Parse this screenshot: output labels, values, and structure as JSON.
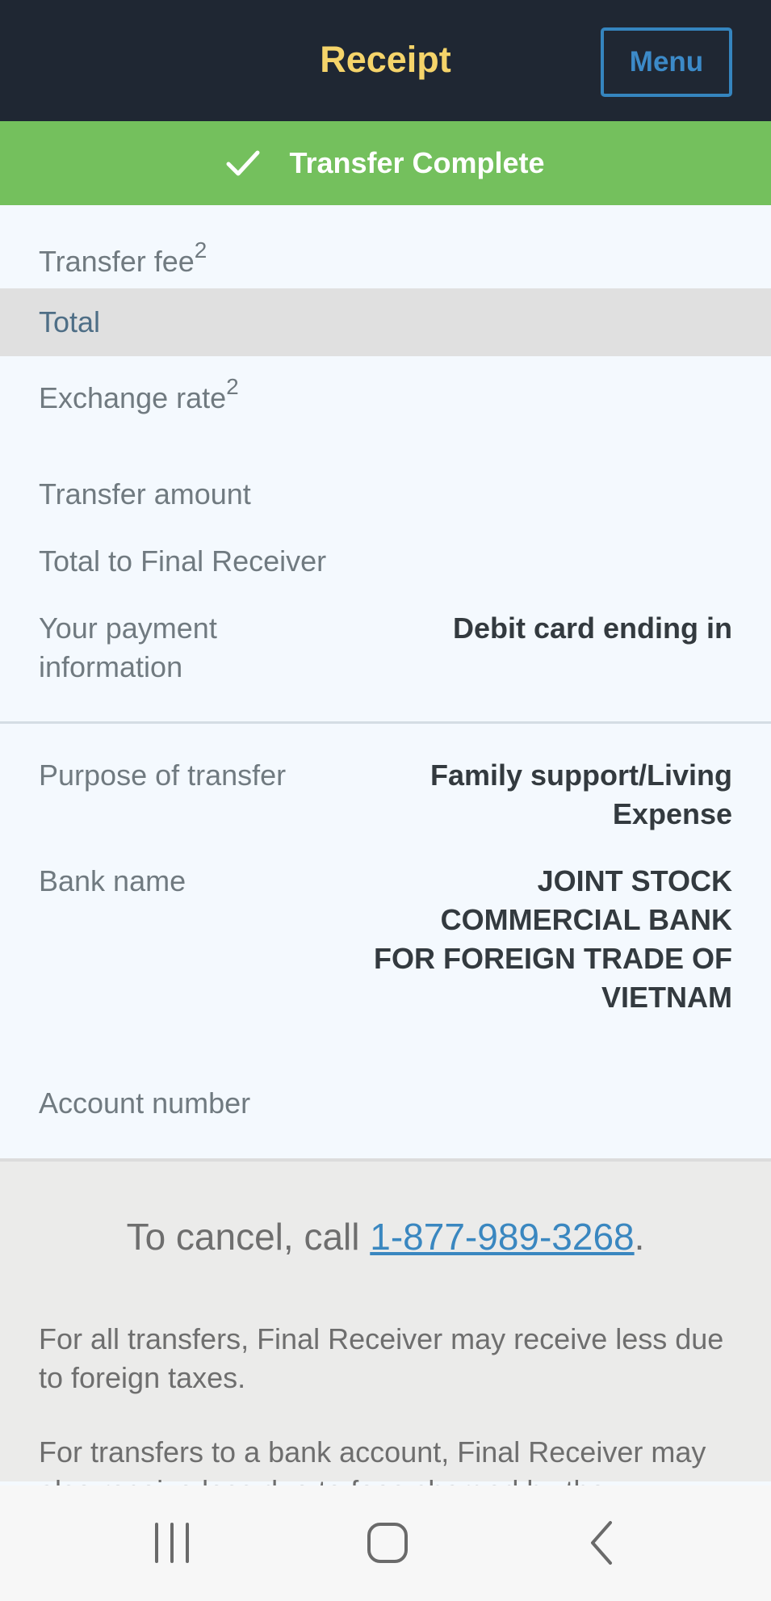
{
  "header": {
    "title": "Receipt",
    "menu_label": "Menu"
  },
  "banner": {
    "icon": "check-icon",
    "text": "Transfer Complete"
  },
  "receipt": {
    "transfer_fee_label": "Transfer fee",
    "transfer_fee_sup": "2",
    "total_label": "Total",
    "exchange_rate_label": "Exchange rate",
    "exchange_rate_sup": "2",
    "transfer_amount_label": "Transfer amount",
    "total_final_label": "Total to Final Receiver",
    "payment_label_line1": "Your payment",
    "payment_label_line2": "information",
    "payment_value": "Debit card ending in",
    "purpose_label": "Purpose of transfer",
    "purpose_value_line1": "Family support/Living",
    "purpose_value_line2": "Expense",
    "bank_label": "Bank name",
    "bank_value_line1": "JOINT STOCK",
    "bank_value_line2": "COMMERCIAL BANK",
    "bank_value_line3": "FOR FOREIGN TRADE OF",
    "bank_value_line4": "VIETNAM",
    "account_label": "Account number"
  },
  "footer": {
    "cancel_prefix": "To cancel, call ",
    "cancel_phone": "1-877-989-3268",
    "cancel_suffix": ".",
    "note1": "For all transfers, Final Receiver may receive less due to foreign taxes.",
    "note2": "For transfers to a bank account, Final Receiver may also receive less due to fees charged by the"
  },
  "colors": {
    "header_bg": "#1f2733",
    "title": "#f5d46a",
    "accent": "#3a87c0",
    "success": "#74c05d"
  },
  "navbar": {
    "icons": [
      "recent-apps-icon",
      "home-icon",
      "back-icon"
    ]
  }
}
